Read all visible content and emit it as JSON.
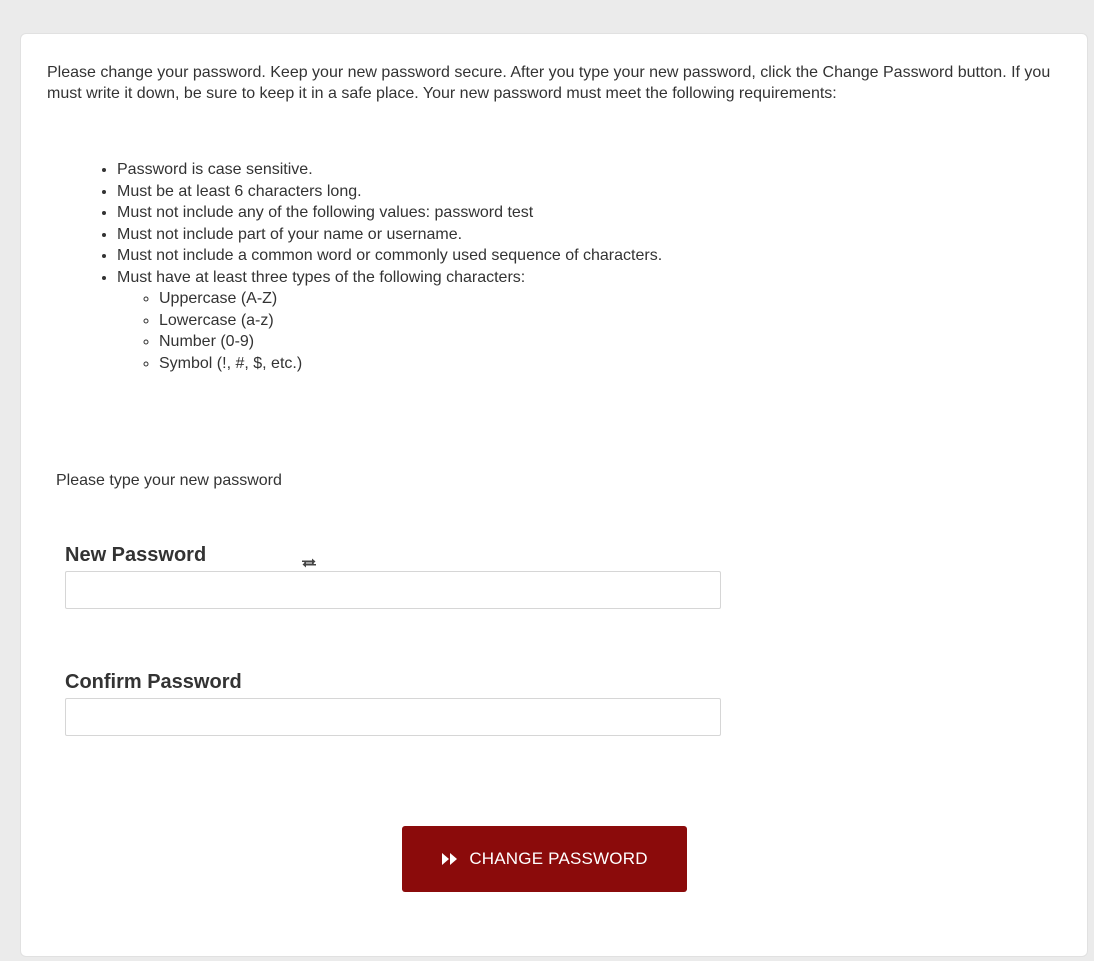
{
  "intro_text": "Please change your password. Keep your new password secure. After you type your new password, click the Change Password button. If you must write it down, be sure to keep it in a safe place. Your new password must meet the following requirements:",
  "requirements": [
    "Password is case sensitive.",
    "Must be at least 6 characters long.",
    "Must not include any of the following values: password test",
    "Must not include part of your name or username.",
    "Must not include a common word or commonly used sequence of characters.",
    "Must have at least three types of the following characters:"
  ],
  "character_types": [
    "Uppercase (A-Z)",
    "Lowercase (a-z)",
    "Number (0-9)",
    "Symbol (!, #, $, etc.)"
  ],
  "prompt": "Please type your new password",
  "new_password": {
    "label": "New Password",
    "value": "",
    "placeholder": "",
    "toggle_icon": "swap-arrows-icon"
  },
  "confirm_password": {
    "label": "Confirm Password",
    "value": "",
    "placeholder": ""
  },
  "submit": {
    "label": "CHANGE PASSWORD",
    "icon": "double-chevron-right-icon"
  },
  "colors": {
    "button_bg": "#8b0b0b",
    "button_text": "#ffffff",
    "text": "#333333",
    "page_bg": "#ebebeb",
    "panel_bg": "#ffffff"
  }
}
